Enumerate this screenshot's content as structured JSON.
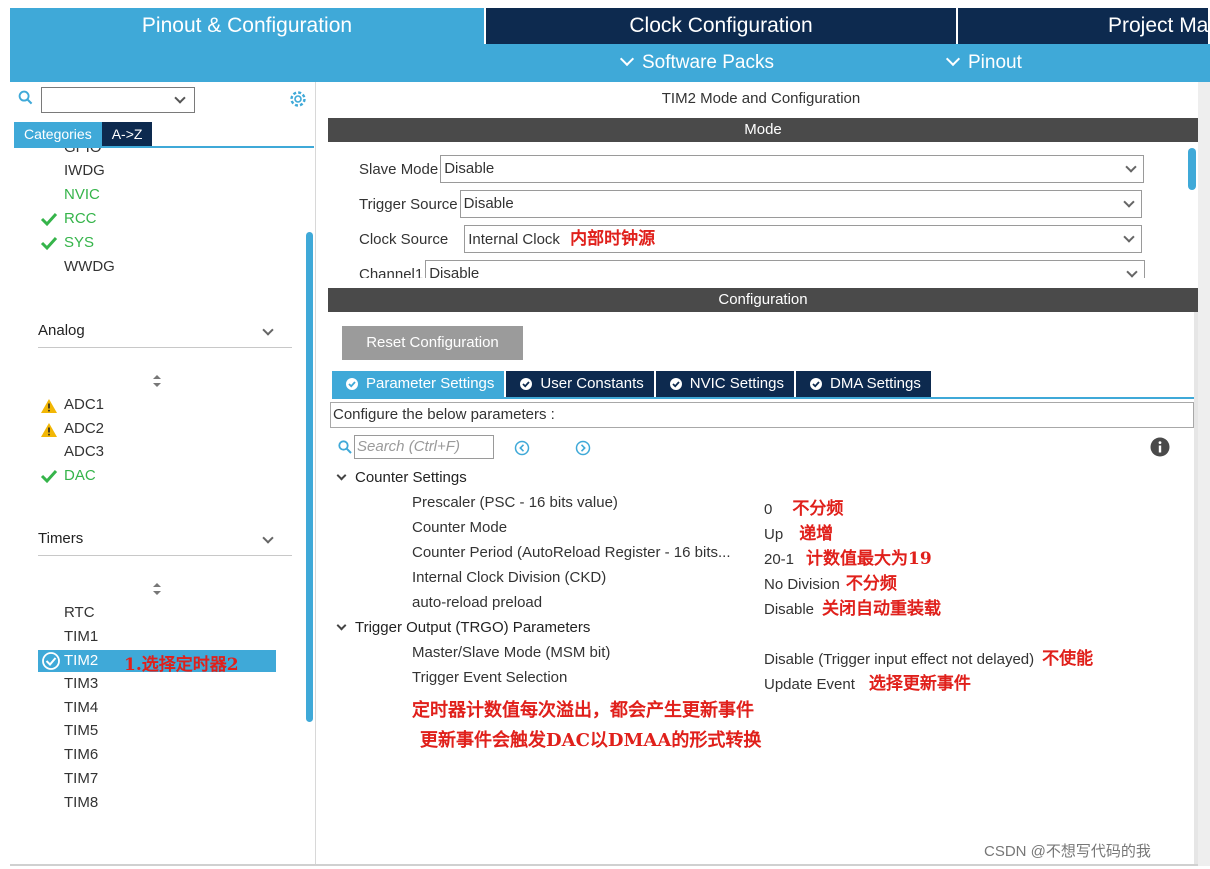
{
  "top_tabs": [
    "Pinout & Configuration",
    "Clock Configuration",
    "Project Ma"
  ],
  "sub_menu": [
    "Software Packs",
    "Pinout"
  ],
  "left": {
    "categories_tab": "Categories",
    "az_tab": "A->Z",
    "system_items": [
      {
        "label": "GPIO",
        "state": "normal"
      },
      {
        "label": "IWDG",
        "state": "normal"
      },
      {
        "label": "NVIC",
        "state": "green"
      },
      {
        "label": "RCC",
        "state": "checked"
      },
      {
        "label": "SYS",
        "state": "checked"
      },
      {
        "label": "WWDG",
        "state": "normal"
      }
    ],
    "analog_title": "Analog",
    "analog_items": [
      {
        "label": "ADC1",
        "state": "warning"
      },
      {
        "label": "ADC2",
        "state": "warning"
      },
      {
        "label": "ADC3",
        "state": "normal"
      },
      {
        "label": "DAC",
        "state": "checked"
      }
    ],
    "timers_title": "Timers",
    "timer_items": [
      "RTC",
      "TIM1",
      "TIM2",
      "TIM3",
      "TIM4",
      "TIM5",
      "TIM6",
      "TIM7",
      "TIM8"
    ],
    "selected_timer_annotation": "1.选择定时器2"
  },
  "right": {
    "title": "TIM2 Mode and Configuration",
    "mode_bar": "Mode",
    "mode_rows": [
      {
        "label": "Slave Mode",
        "value": "Disable"
      },
      {
        "label": "Trigger Source",
        "value": "Disable"
      },
      {
        "label": "Clock Source",
        "value": "Internal Clock",
        "annotation": "内部时钟源"
      },
      {
        "label": "Channel1",
        "value": "Disable"
      }
    ],
    "config_bar": "Configuration",
    "reset_button": "Reset Configuration",
    "tabs": [
      "Parameter Settings",
      "User Constants",
      "NVIC Settings",
      "DMA Settings"
    ],
    "description": "Configure the below parameters :",
    "search_placeholder": "Search (Ctrl+F)",
    "counter_group": "Counter Settings",
    "counter_params": [
      {
        "label": "Prescaler (PSC - 16 bits value)",
        "value": "0",
        "annotation": "不分频"
      },
      {
        "label": "Counter Mode",
        "value": "Up",
        "annotation": "递增"
      },
      {
        "label": "Counter Period (AutoReload Register - 16 bits...",
        "value": "20-1",
        "annotation": "计数值最大为19"
      },
      {
        "label": "Internal Clock Division (CKD)",
        "value": "No Division",
        "annotation": "不分频"
      },
      {
        "label": "auto-reload preload",
        "value": "Disable",
        "annotation": "关闭自动重装载"
      }
    ],
    "trgo_group": "Trigger Output (TRGO) Parameters",
    "trgo_params": [
      {
        "label": "Master/Slave Mode (MSM bit)",
        "value": "Disable (Trigger input effect not delayed)",
        "annotation": "不使能"
      },
      {
        "label": "Trigger Event Selection",
        "value": "Update Event",
        "annotation": "选择更新事件"
      }
    ],
    "notes": [
      "定时器计数值每次溢出，都会产生更新事件",
      "更新事件会触发DAC以DMAA的形式转换"
    ]
  },
  "watermark": "CSDN @不想写代码的我",
  "colors": {
    "accent": "#3fa9d8",
    "dark_tab": "#0d2a4f",
    "section_bar": "#4a4a4a",
    "annotation": "#e0201b",
    "ok_green": "#35b44a"
  }
}
